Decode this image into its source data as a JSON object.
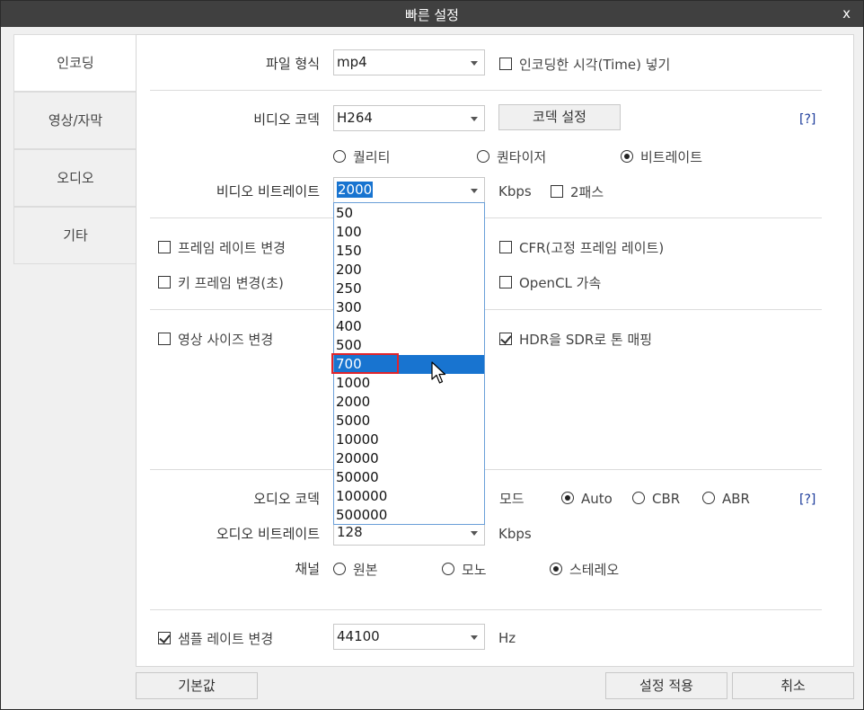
{
  "window": {
    "title": "빠른 설정",
    "close": "x"
  },
  "tabs": [
    "인코딩",
    "영상/자막",
    "오디오",
    "기타"
  ],
  "file": {
    "label": "파일 형식",
    "format": "mp4",
    "burn_time_label": "인코딩한 시각(Time) 넣기"
  },
  "video": {
    "codec_label": "비디오 코덱",
    "codec": "H264",
    "codec_settings_btn": "코덱 설정",
    "help": "[?]",
    "modes": [
      "퀄리티",
      "퀀타이저",
      "비트레이트"
    ],
    "bitrate_label": "비디오 비트레이트",
    "bitrate": "2000",
    "unit": "Kbps",
    "two_pass": "2패스"
  },
  "bitrate_options": [
    "50",
    "100",
    "150",
    "200",
    "250",
    "300",
    "400",
    "500",
    "700",
    "1000",
    "2000",
    "5000",
    "10000",
    "20000",
    "50000",
    "100000",
    "500000"
  ],
  "options": {
    "frame_rate": "프레임 레이트 변경",
    "cfr": "CFR(고정 프레임 레이트)",
    "keyframe": "키 프레임 변경(초)",
    "opencl": "OpenCL 가속",
    "resize": "영상 사이즈 변경",
    "hdr": "HDR을 SDR로 톤 매핑"
  },
  "audio": {
    "codec_label": "오디오 코덱",
    "mode_label": "모드",
    "modes": [
      "Auto",
      "CBR",
      "ABR"
    ],
    "help": "[?]",
    "bitrate_label": "오디오 비트레이트",
    "bitrate": "128",
    "unit": "Kbps",
    "channel_label": "채널",
    "channels": [
      "원본",
      "모노",
      "스테레오"
    ],
    "samplerate_label": "샘플 레이트 변경",
    "samplerate": "44100",
    "samplerate_unit": "Hz"
  },
  "footer": {
    "defaults": "기본값",
    "apply": "설정 적용",
    "cancel": "취소"
  }
}
